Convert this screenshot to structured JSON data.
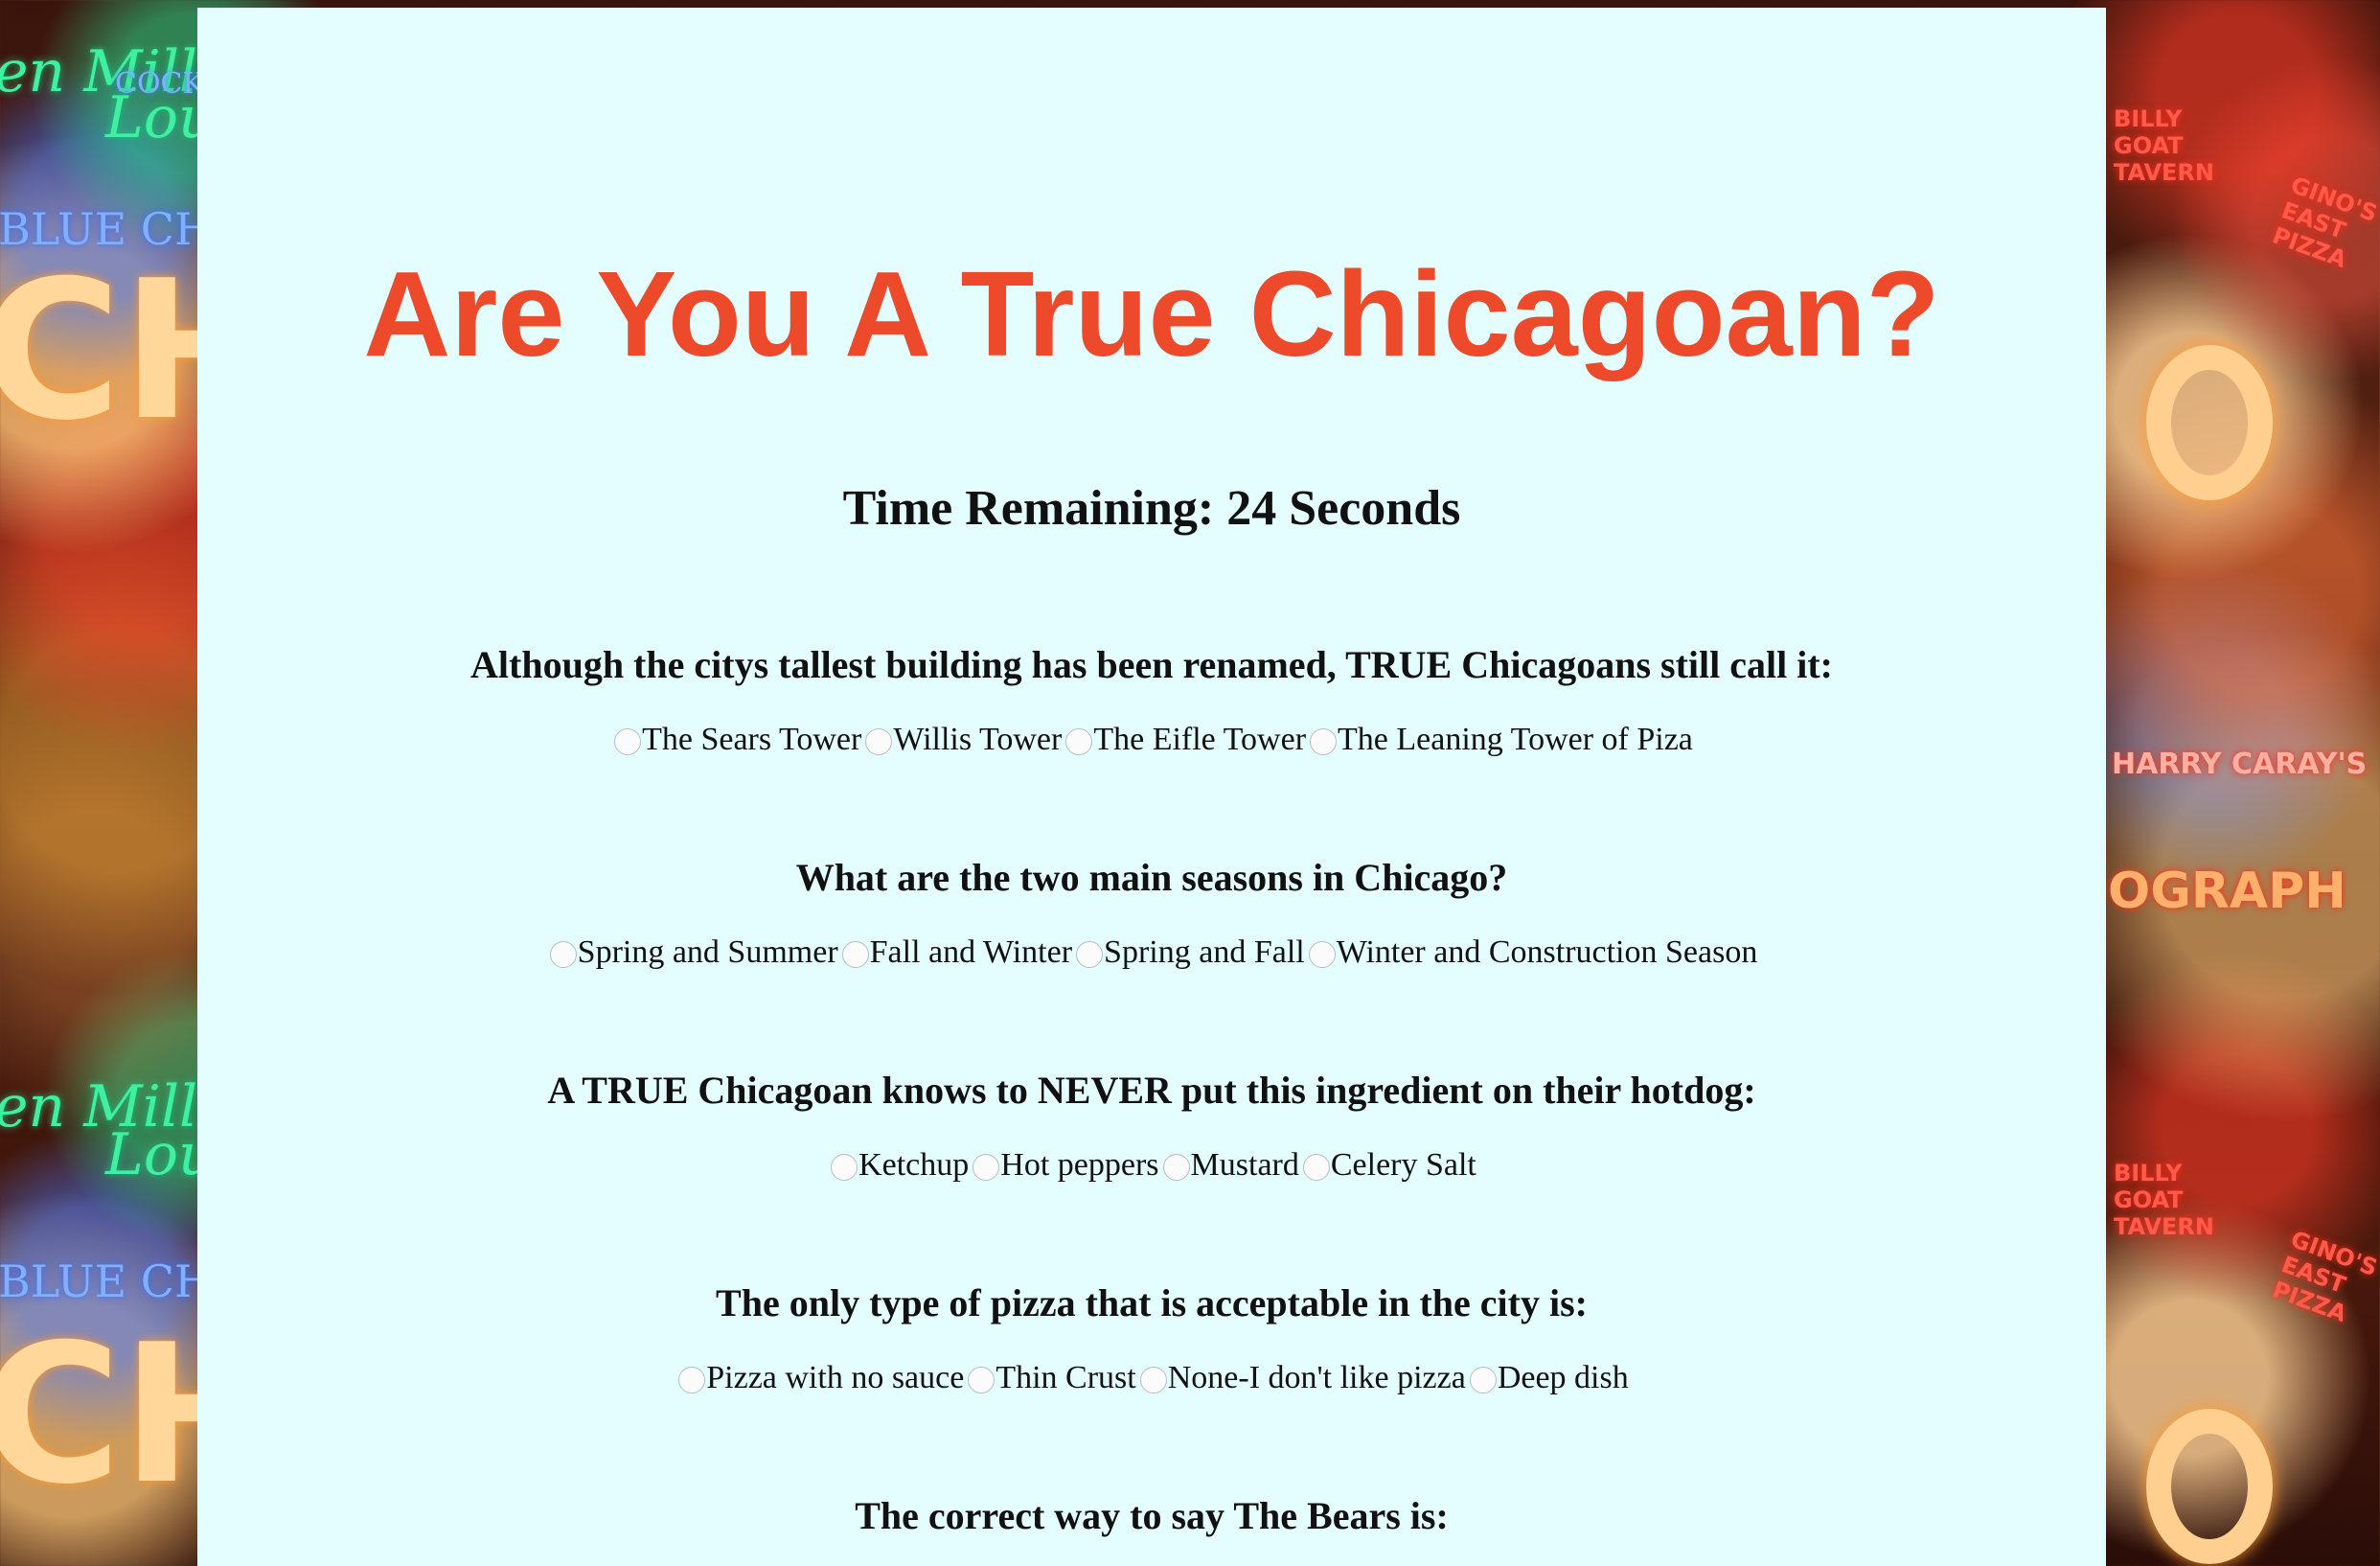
{
  "page": {
    "title": "Are You A True Chicagoan?",
    "timer": "Time Remaining: 24 Seconds"
  },
  "background": {
    "signs": [
      "en Mill",
      "COCKT",
      "Loun",
      "BLUE CHICA",
      "CH",
      "en Mill",
      "Loun",
      "BLUE CHICA",
      "CH",
      "BILLY GOAT TAVERN",
      "GINO'S EAST PIZZA",
      "HARRY CARAY'S",
      "OGRAPH",
      "BILLY GOAT TAVERN",
      "GINO'S EAST PIZZA"
    ]
  },
  "questions": [
    {
      "text": "Although the citys tallest building has been renamed, TRUE Chicagoans still call it:",
      "options": [
        "The Sears Tower",
        "Willis Tower",
        "The Eifle Tower",
        "The Leaning Tower of Piza"
      ]
    },
    {
      "text": "What are the two main seasons in Chicago?",
      "options": [
        "Spring and Summer",
        "Fall and Winter",
        "Spring and Fall",
        "Winter and Construction Season"
      ]
    },
    {
      "text": "A TRUE Chicagoan knows to NEVER put this ingredient on their hotdog:",
      "options": [
        "Ketchup",
        "Hot peppers",
        "Mustard",
        "Celery Salt"
      ]
    },
    {
      "text": "The only type of pizza that is acceptable in the city is:",
      "options": [
        "Pizza with no sauce",
        "Thin Crust",
        "None-I don't like pizza",
        "Deep dish"
      ]
    },
    {
      "text": "The correct way to say The Bears is:",
      "options": []
    }
  ]
}
